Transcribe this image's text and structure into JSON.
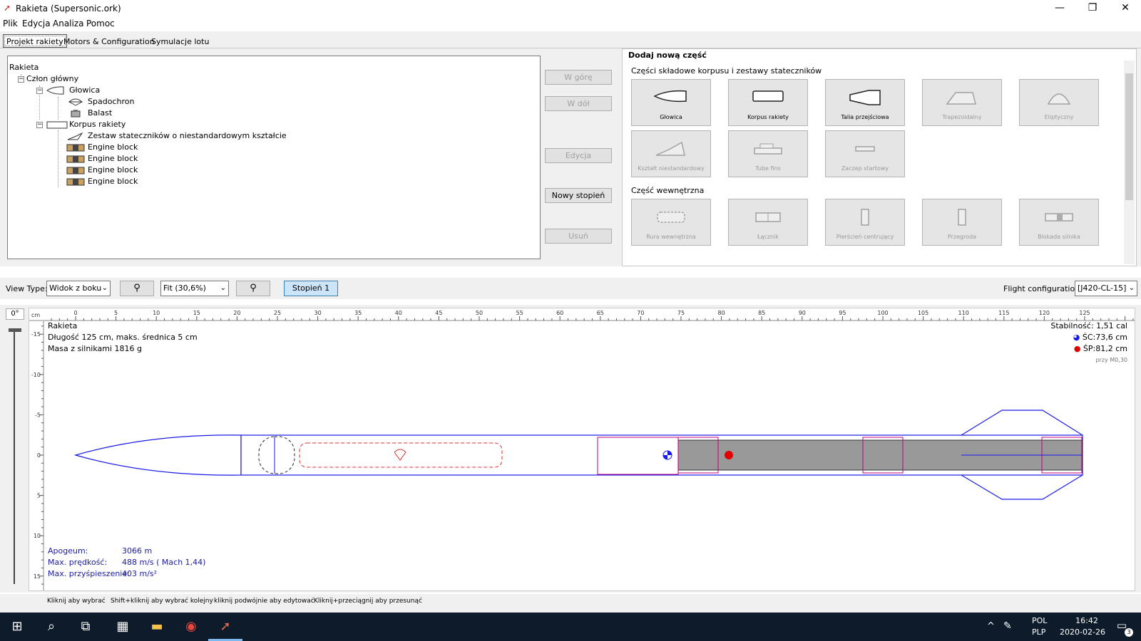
{
  "window": {
    "title": "Rakieta (Supersonic.ork)",
    "minimize": "—",
    "maximize": "❐",
    "close": "✕"
  },
  "menu": [
    "Plik",
    "Edycja",
    "Analiza",
    "Pomoc"
  ],
  "tabs": [
    "Projekt rakiety",
    "Motors & Configuration",
    "Symulacje lotu"
  ],
  "tree": {
    "root": "Rakieta",
    "stage": "Człon główny",
    "nose": "Głowica",
    "parachute": "Spadochron",
    "ballast": "Balast",
    "body": "Korpus rakiety",
    "fins": "Zestaw stateczników o niestandardowym kształcie",
    "engine_blocks": [
      "Engine block",
      "Engine block",
      "Engine block",
      "Engine block"
    ]
  },
  "side_buttons": {
    "up": "W górę",
    "down": "W dół",
    "edit": "Edycja",
    "new_stage": "Nowy stopień",
    "delete": "Usuń"
  },
  "palette": {
    "title": "Dodaj nową część",
    "body_section": "Części składowe korpusu i zestawy stateczników",
    "body_parts": [
      "Głowica",
      "Korpus rakiety",
      "Talia przejściowa",
      "Trapezoidalny",
      "Eliptyczny",
      "Kształt niestandardowy",
      "Tube fins",
      "Zaczep startowy"
    ],
    "inner_section": "Część wewnętrzna",
    "inner_parts": [
      "Rura wewnętrzna",
      "Łącznik",
      "Pierścień centrujący",
      "Przegroda",
      "Blokada silnika"
    ]
  },
  "view_toolbar": {
    "view_type_label": "View Type:",
    "view_type": "Widok z boku",
    "zoom": "Fit (30,6%)",
    "stage": "Stopień 1",
    "flight_config_label": "Flight configuration:",
    "flight_config": "[J420-CL-15]"
  },
  "ruler": {
    "unit": "cm",
    "angle": "0°",
    "h_labels": [
      "0",
      "5",
      "10",
      "15",
      "20",
      "25",
      "30",
      "35",
      "40",
      "45",
      "50",
      "55",
      "60",
      "65",
      "70",
      "75",
      "80",
      "85",
      "90",
      "95",
      "100",
      "105",
      "110",
      "115",
      "120",
      "125"
    ],
    "v_labels": [
      "-15",
      "-10",
      "-5",
      "0",
      "5",
      "10",
      "15"
    ]
  },
  "rocket_info": {
    "name": "Rakieta",
    "dims": "Długość 125 cm, maks. średnica 5 cm",
    "mass": "Masa z silnikami 1816 g",
    "stability": "Stabilność: 1,51 cal",
    "cg": "ŚC:73,6 cm",
    "cp": "ŚP:81,2 cm",
    "mach": "przy M0,30"
  },
  "flight_stats": {
    "apogee_label": "Apogeum:",
    "apogee": "3066 m",
    "vel_label": "Max. prędkość:",
    "vel": "488 m/s  ( Mach 1,44)",
    "acc_label": "Max. przyśpieszenie:",
    "acc": "403 m/s²"
  },
  "hints": [
    "Kliknij aby wybrać",
    "Shift+kliknij aby wybrać kolejny",
    "kliknij podwójnie aby edytować",
    "Kliknij+przeciągnij aby przesunąć"
  ],
  "taskbar": {
    "lang1": "POL",
    "lang2": "PLP",
    "time": "16:42",
    "date": "2020-02-26",
    "notif": "3"
  },
  "colors": {
    "outline": "#1a1ae6",
    "accent": "#0078d7",
    "motor": "#999999",
    "recovery": "#e03030",
    "inner": "#c0007f"
  }
}
